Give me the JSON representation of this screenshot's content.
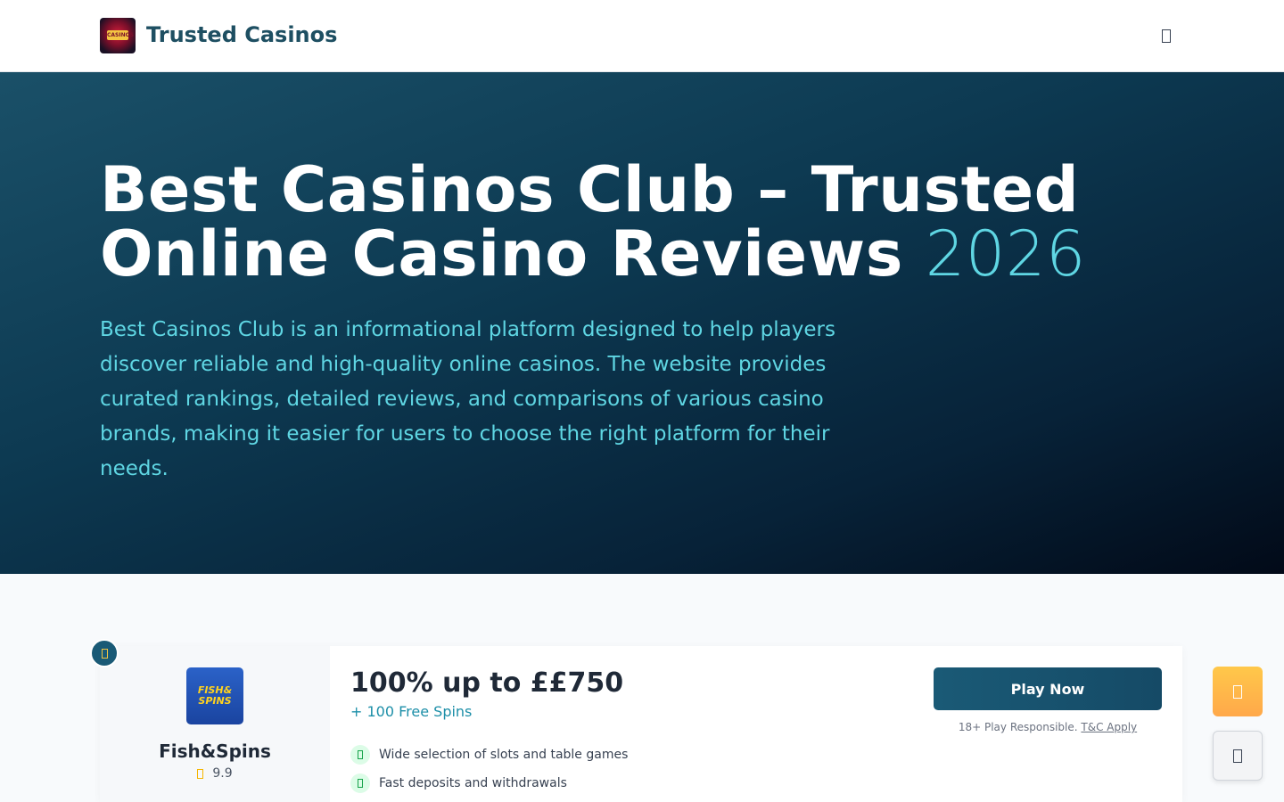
{
  "header": {
    "logo_text": "CASINOS",
    "brand": "Trusted Casinos",
    "menu_icon": "menu-icon"
  },
  "hero": {
    "title_main": "Best Casinos Club – Trusted Online Casino Reviews",
    "title_year": "2026",
    "description": "Best Casinos Club is an informational platform designed to help players discover reliable and high-quality online casinos. The website provides curated rankings, detailed reviews, and comparisons of various casino brands, making it easier for users to choose the right platform for their needs."
  },
  "casino_card": {
    "rank_icon": "crown-icon",
    "logo_line1": "FISH&",
    "logo_line2": "SPINS",
    "name": "Fish&Spins",
    "rating": "9.9",
    "bonus_title": "100% up to ££750",
    "bonus_sub": "+ 100 Free Spins",
    "features": [
      "Wide selection of slots and table games",
      "Fast deposits and withdrawals"
    ],
    "cta": "Play Now",
    "disclaimer_prefix": "18+ Play Responsible.",
    "disclaimer_link": "T&C Apply"
  },
  "floating": {
    "gift_icon": "gift-icon",
    "secondary_icon": "widget-icon"
  },
  "colors": {
    "brand": "#1e4f62",
    "accent_cyan": "#5fd6e3",
    "hero_bg_start": "#1a5068",
    "hero_bg_end": "#020a18",
    "cta_bg": "#1a5a76",
    "gift_bg": "#ffb84a",
    "check_green": "#16a34a",
    "star_gold": "#f5b500"
  }
}
